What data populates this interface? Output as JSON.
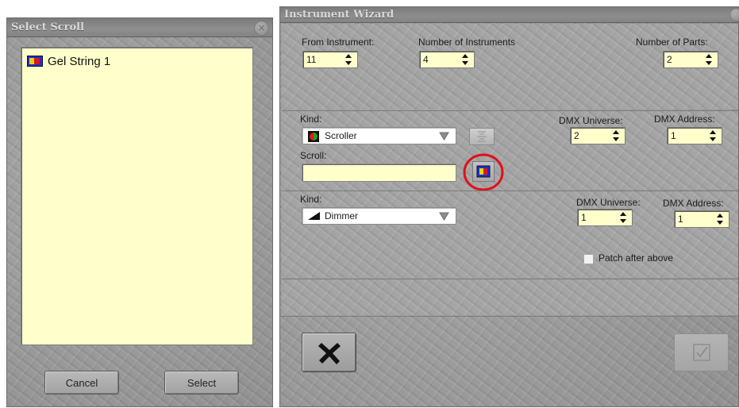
{
  "select_scroll": {
    "title": "Select Scroll",
    "list_items": [
      {
        "label": "Gel String 1",
        "icon": "scroll-icon"
      }
    ],
    "cancel_label": "Cancel",
    "select_label": "Select"
  },
  "wizard": {
    "title": "Instrument Wizard",
    "from_instrument": {
      "label": "From Instrument:",
      "value": "11"
    },
    "number_of_instruments": {
      "label": "Number of Instruments",
      "value": "4"
    },
    "number_of_parts": {
      "label": "Number of Parts:",
      "value": "2"
    },
    "part1": {
      "kind_label": "Kind:",
      "kind_value": "Scroller",
      "dmx_universe_label": "DMX Universe:",
      "dmx_universe_value": "2",
      "dmx_address_label": "DMX Address:",
      "dmx_address_value": "1",
      "scroll_label": "Scroll:",
      "scroll_value": ""
    },
    "part2": {
      "kind_label": "Kind:",
      "kind_value": "Dimmer",
      "dmx_universe_label": "DMX Universe:",
      "dmx_universe_value": "1",
      "dmx_address_label": "DMX Address:",
      "dmx_address_value": "1",
      "patch_label": "Patch after above",
      "patch_checked": false
    }
  },
  "colors": {
    "list_background": "#ffffcc",
    "highlight_ring": "#e0101a",
    "panel_gray": "#9a9a9a"
  }
}
